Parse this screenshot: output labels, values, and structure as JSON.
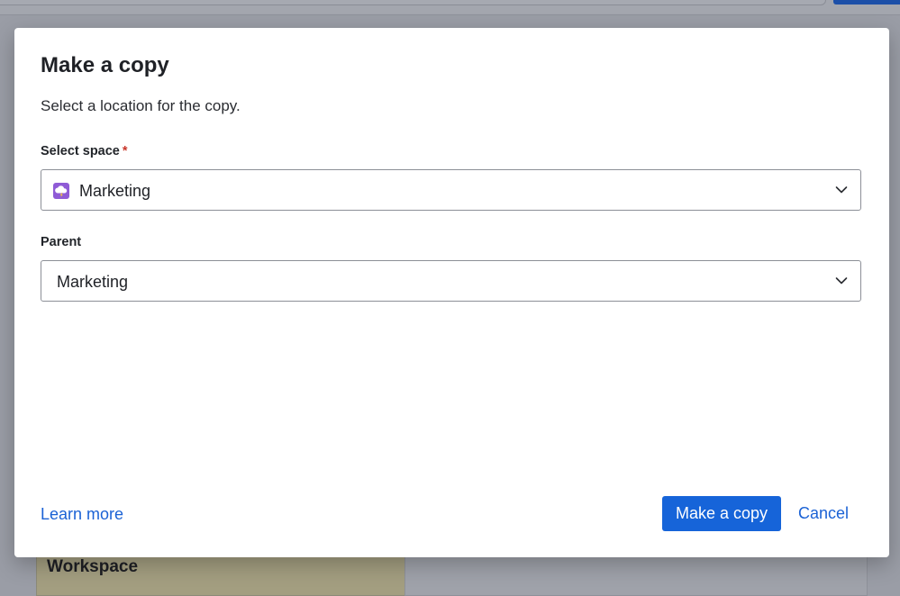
{
  "background": {
    "card_title": "Workspace"
  },
  "dialog": {
    "title": "Make a copy",
    "description": "Select a location for the copy.",
    "space_field": {
      "label": "Select space",
      "required_marker": "*",
      "value": "Marketing",
      "icon": "cloud-lightning-icon",
      "icon_color": "#8f5bd6"
    },
    "parent_field": {
      "label": "Parent",
      "value": "Marketing"
    },
    "learn_more_label": "Learn more",
    "primary_label": "Make a copy",
    "cancel_label": "Cancel"
  },
  "colors": {
    "primary": "#1664d9",
    "link": "#1b62d5",
    "required": "#c9372c"
  }
}
